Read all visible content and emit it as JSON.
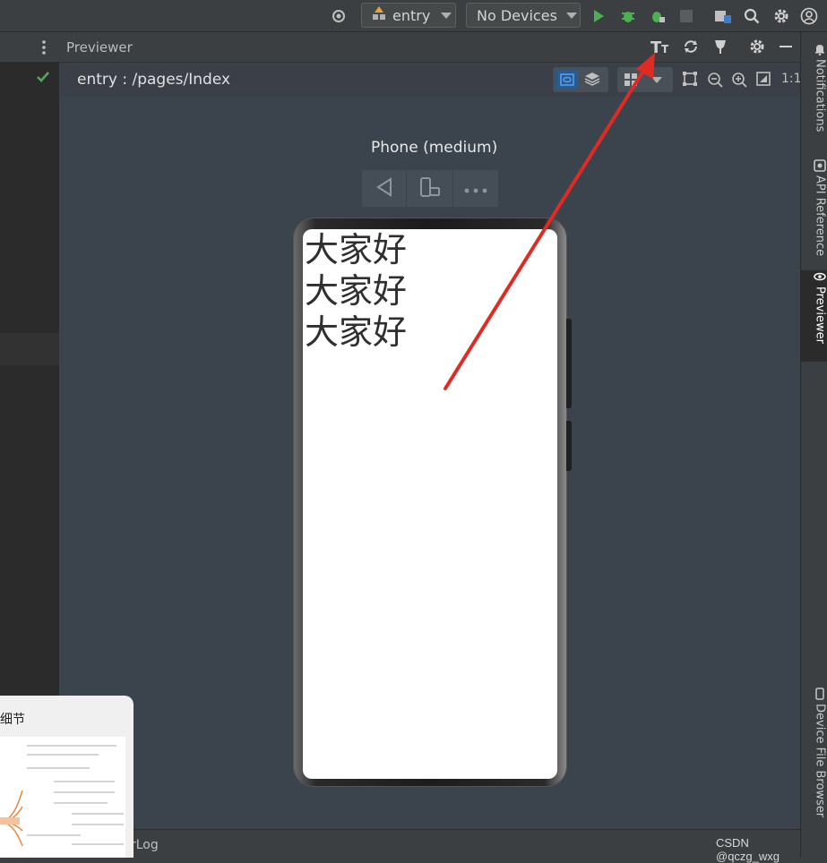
{
  "toolbar": {
    "run_config": "entry",
    "device_selector": "No Devices"
  },
  "previewer": {
    "panel_title": "Previewer",
    "page_path": "entry : /pages/Index",
    "device_label": "Phone (medium)",
    "zoom_ratio": "1:1"
  },
  "phone_screen": {
    "lines": [
      "大家好",
      "大家好",
      "大家好"
    ]
  },
  "right_tabs": {
    "notifications": "Notifications",
    "api_reference": "API Reference",
    "previewer": "Previewer",
    "device_file_browser": "Device File Browser"
  },
  "statusbar": {
    "hilog_tab": "rLog",
    "watermark": "CSDN @qczg_wxg"
  },
  "thumbnail": {
    "caption": "细节"
  },
  "colors": {
    "annotation_arrow": "#e02a24",
    "run_green": "#4caf50",
    "check_green": "#56a85a"
  }
}
